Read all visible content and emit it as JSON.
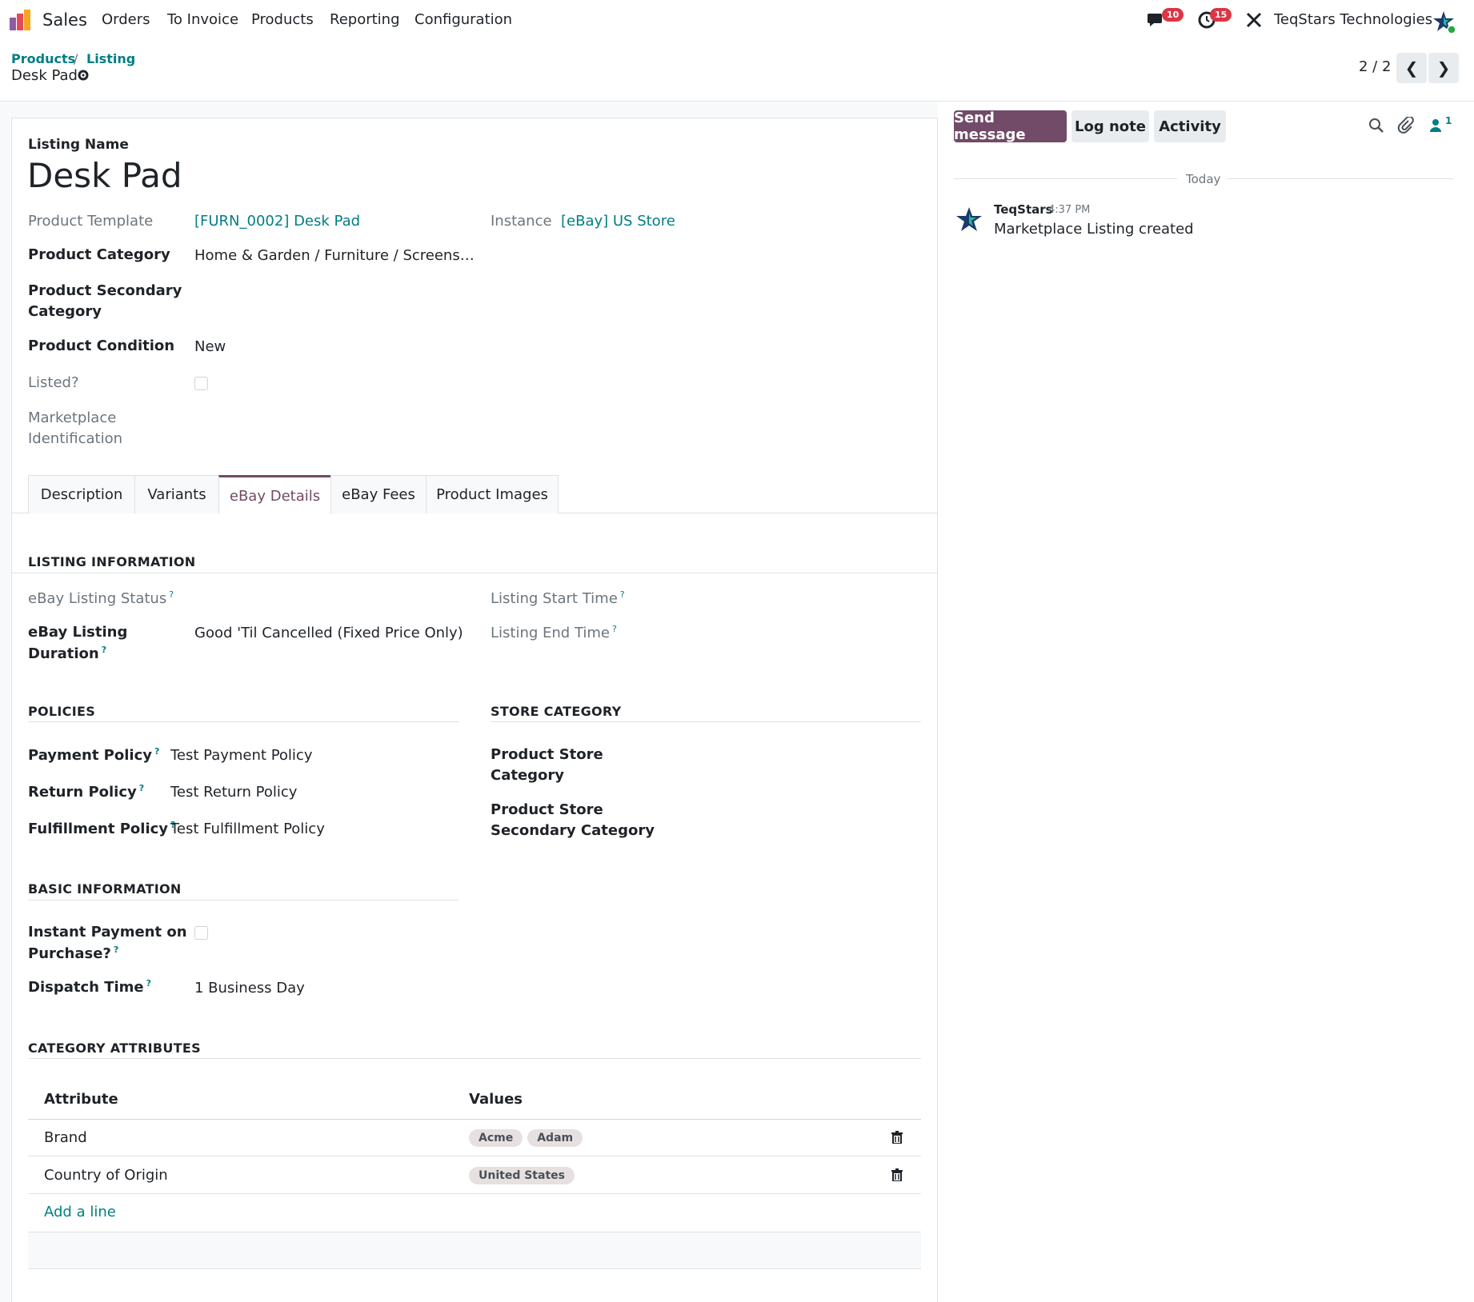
{
  "topbar": {
    "app_name": "Sales",
    "menu": [
      "Orders",
      "To Invoice",
      "Products",
      "Reporting",
      "Configuration"
    ],
    "messages_badge": "10",
    "activities_badge": "15",
    "company": "TeqStars Technologies"
  },
  "breadcrumb": {
    "products": "Products",
    "separator": "/",
    "listing": "Listing",
    "current": "Desk Pad",
    "pager": "2 / 2"
  },
  "form": {
    "listing_name_label": "Listing Name",
    "listing_name": "Desk Pad",
    "product_template_label": "Product Template",
    "product_template": "[FURN_0002] Desk Pad",
    "instance_label": "Instance",
    "instance": "[eBay] US Store",
    "product_category_label": "Product Category",
    "product_category": "Home & Garden / Furniture / Screens…",
    "product_secondary_category_label_1": "Product Secondary",
    "product_secondary_category_label_2": "Category",
    "product_condition_label": "Product Condition",
    "product_condition": "New",
    "listed_label": "Listed?",
    "marketplace_identification_label_1": "Marketplace",
    "marketplace_identification_label_2": "Identification"
  },
  "tabs": [
    "Description",
    "Variants",
    "eBay Details",
    "eBay Fees",
    "Product Images"
  ],
  "ebay_details": {
    "listing_information_title": "LISTING INFORMATION",
    "listing_status_label": "eBay Listing Status",
    "listing_start_time_label": "Listing Start Time",
    "listing_duration_label_1": "eBay Listing",
    "listing_duration_label_2": "Duration",
    "listing_duration": "Good 'Til Cancelled (Fixed Price Only)",
    "listing_end_time_label": "Listing End Time",
    "policies_title": "POLICIES",
    "payment_policy_label": "Payment Policy",
    "payment_policy": "Test Payment Policy",
    "return_policy_label": "Return Policy",
    "return_policy": "Test Return Policy",
    "fulfillment_policy_label": "Fulfillment Policy",
    "fulfillment_policy": "Test Fulfillment Policy",
    "store_category_title": "STORE CATEGORY",
    "product_store_category_label_1": "Product Store",
    "product_store_category_label_2": "Category",
    "product_store_secondary_category_label_1": "Product Store",
    "product_store_secondary_category_label_2": "Secondary Category",
    "basic_information_title": "BASIC INFORMATION",
    "instant_payment_label_1": "Instant Payment on",
    "instant_payment_label_2": "Purchase?",
    "dispatch_time_label": "Dispatch Time",
    "dispatch_time": "1 Business Day",
    "category_attributes_title": "CATEGORY ATTRIBUTES",
    "help_mark": "?"
  },
  "attributes_table": {
    "headers": [
      "Attribute",
      "Values"
    ],
    "rows": [
      {
        "attribute": "Brand",
        "values": [
          "Acme",
          "Adam"
        ]
      },
      {
        "attribute": "Country of Origin",
        "values": [
          "United States"
        ]
      }
    ],
    "add_line": "Add a line"
  },
  "chatter": {
    "send_message": "Send message",
    "log_note": "Log note",
    "activity": "Activity",
    "followers_count": "1",
    "date_separator": "Today",
    "message_author": "TeqStars",
    "message_time": "4:37 PM",
    "message_body": "Marketplace Listing created"
  },
  "colors": {
    "brand": "#714b67",
    "link": "#017e84",
    "badge": "#dc3545"
  }
}
